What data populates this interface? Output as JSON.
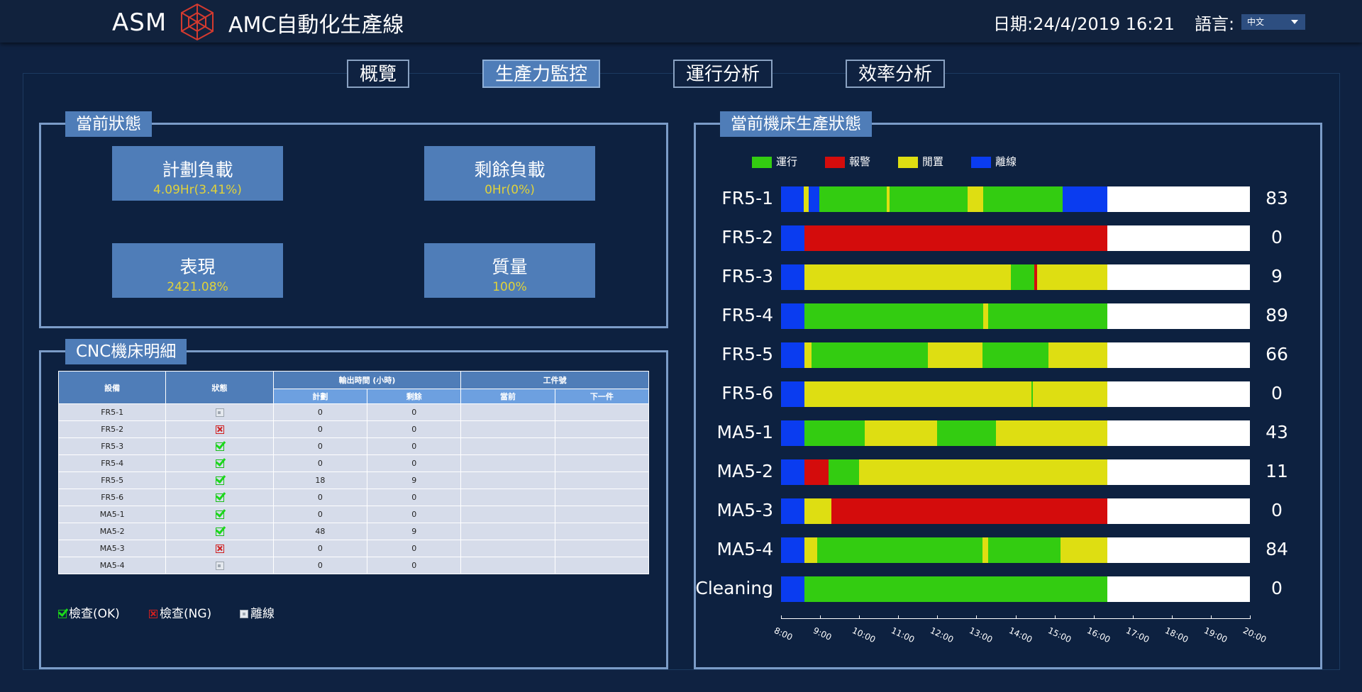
{
  "header": {
    "brand": "ASM",
    "title": "AMC自動化生產線",
    "date_label": "日期:24/4/2019 16:21",
    "language_label": "語言:",
    "language_value": "中文"
  },
  "nav": {
    "tabs": [
      {
        "label": "概覽",
        "active": false
      },
      {
        "label": "生產力監控",
        "active": true
      },
      {
        "label": "運行分析",
        "active": false
      },
      {
        "label": "效率分析",
        "active": false
      }
    ]
  },
  "status_panel": {
    "title": "當前狀態",
    "kpis": [
      {
        "label": "計劃負載",
        "value": "4.09Hr(3.41%)"
      },
      {
        "label": "剩餘負載",
        "value": "0Hr(0%)"
      },
      {
        "label": "表現",
        "value": "2421.08%"
      },
      {
        "label": "質量",
        "value": "100%"
      }
    ]
  },
  "cnc_panel": {
    "title": "CNC機床明細",
    "headers": {
      "equipment": "設備",
      "status": "狀態",
      "output_time": "輸出時間 (小時)",
      "plan": "計劃",
      "remain": "剩餘",
      "workpiece": "工件號",
      "current": "當前",
      "next": "下一件"
    },
    "rows": [
      {
        "equipment": "FR5-1",
        "status": "offline",
        "plan": "0",
        "remain": "0",
        "current": "",
        "next": ""
      },
      {
        "equipment": "FR5-2",
        "status": "ng",
        "plan": "0",
        "remain": "0",
        "current": "",
        "next": ""
      },
      {
        "equipment": "FR5-3",
        "status": "ok",
        "plan": "0",
        "remain": "0",
        "current": "",
        "next": ""
      },
      {
        "equipment": "FR5-4",
        "status": "ok",
        "plan": "0",
        "remain": "0",
        "current": "",
        "next": ""
      },
      {
        "equipment": "FR5-5",
        "status": "ok",
        "plan": "18",
        "remain": "9",
        "current": "",
        "next": ""
      },
      {
        "equipment": "FR5-6",
        "status": "ok",
        "plan": "0",
        "remain": "0",
        "current": "",
        "next": ""
      },
      {
        "equipment": "MA5-1",
        "status": "ok",
        "plan": "0",
        "remain": "0",
        "current": "",
        "next": ""
      },
      {
        "equipment": "MA5-2",
        "status": "ok",
        "plan": "48",
        "remain": "9",
        "current": "",
        "next": ""
      },
      {
        "equipment": "MA5-3",
        "status": "ng",
        "plan": "0",
        "remain": "0",
        "current": "",
        "next": ""
      },
      {
        "equipment": "MA5-4",
        "status": "offline",
        "plan": "0",
        "remain": "0",
        "current": "",
        "next": ""
      }
    ],
    "legend": {
      "ok": "檢查(OK)",
      "ng": "檢查(NG)",
      "offline": "離線"
    }
  },
  "machine_panel": {
    "title": "當前機床生產狀態",
    "legend": [
      {
        "key": "run",
        "label": "運行",
        "color": "#33cc11"
      },
      {
        "key": "alarm",
        "label": "報警",
        "color": "#d40c0c"
      },
      {
        "key": "idle",
        "label": "閒置",
        "color": "#dede12"
      },
      {
        "key": "offline",
        "label": "離線",
        "color": "#0a3cf0"
      }
    ]
  },
  "chart_data": {
    "type": "gantt",
    "x_ticks": [
      "8:00",
      "9:00",
      "10:00",
      "11:00",
      "12:00",
      "13:00",
      "14:00",
      "15:00",
      "16:00",
      "17:00",
      "18:00",
      "19:00",
      "20:00"
    ],
    "x_range_hours": [
      8,
      20
    ],
    "state_colors": {
      "run": "#33cc11",
      "alarm": "#d40c0c",
      "idle": "#dede12",
      "offline": "#0a3cf0"
    },
    "rows": [
      {
        "label": "FR5-1",
        "count": "83",
        "segments": [
          {
            "state": "offline",
            "start": 8.0,
            "end": 8.58
          },
          {
            "state": "idle",
            "start": 8.58,
            "end": 8.7
          },
          {
            "state": "offline",
            "start": 8.7,
            "end": 8.98
          },
          {
            "state": "run",
            "start": 8.98,
            "end": 10.7
          },
          {
            "state": "idle",
            "start": 10.7,
            "end": 10.78
          },
          {
            "state": "run",
            "start": 10.78,
            "end": 12.78
          },
          {
            "state": "idle",
            "start": 12.78,
            "end": 13.18
          },
          {
            "state": "run",
            "start": 13.18,
            "end": 15.2
          },
          {
            "state": "offline",
            "start": 15.2,
            "end": 16.35
          }
        ]
      },
      {
        "label": "FR5-2",
        "count": "0",
        "segments": [
          {
            "state": "offline",
            "start": 8.0,
            "end": 8.6
          },
          {
            "state": "alarm",
            "start": 8.6,
            "end": 16.35
          }
        ]
      },
      {
        "label": "FR5-3",
        "count": "9",
        "segments": [
          {
            "state": "offline",
            "start": 8.0,
            "end": 8.6
          },
          {
            "state": "idle",
            "start": 8.6,
            "end": 13.88
          },
          {
            "state": "run",
            "start": 13.88,
            "end": 14.48
          },
          {
            "state": "alarm",
            "start": 14.48,
            "end": 14.56
          },
          {
            "state": "idle",
            "start": 14.56,
            "end": 16.35
          }
        ]
      },
      {
        "label": "FR5-4",
        "count": "89",
        "segments": [
          {
            "state": "offline",
            "start": 8.0,
            "end": 8.6
          },
          {
            "state": "run",
            "start": 8.6,
            "end": 13.18
          },
          {
            "state": "idle",
            "start": 13.18,
            "end": 13.3
          },
          {
            "state": "run",
            "start": 13.3,
            "end": 16.35
          }
        ]
      },
      {
        "label": "FR5-5",
        "count": "66",
        "segments": [
          {
            "state": "offline",
            "start": 8.0,
            "end": 8.6
          },
          {
            "state": "idle",
            "start": 8.6,
            "end": 8.78
          },
          {
            "state": "run",
            "start": 8.78,
            "end": 11.75
          },
          {
            "state": "idle",
            "start": 11.75,
            "end": 13.15
          },
          {
            "state": "run",
            "start": 13.15,
            "end": 14.85
          },
          {
            "state": "idle",
            "start": 14.85,
            "end": 16.35
          }
        ]
      },
      {
        "label": "FR5-6",
        "count": "0",
        "segments": [
          {
            "state": "offline",
            "start": 8.0,
            "end": 8.6
          },
          {
            "state": "idle",
            "start": 8.6,
            "end": 14.4
          },
          {
            "state": "run",
            "start": 14.4,
            "end": 14.45
          },
          {
            "state": "idle",
            "start": 14.45,
            "end": 16.35
          }
        ]
      },
      {
        "label": "MA5-1",
        "count": "43",
        "segments": [
          {
            "state": "offline",
            "start": 8.0,
            "end": 8.6
          },
          {
            "state": "run",
            "start": 8.6,
            "end": 10.15
          },
          {
            "state": "idle",
            "start": 10.15,
            "end": 12.0
          },
          {
            "state": "run",
            "start": 12.0,
            "end": 13.5
          },
          {
            "state": "idle",
            "start": 13.5,
            "end": 16.35
          }
        ]
      },
      {
        "label": "MA5-2",
        "count": "11",
        "segments": [
          {
            "state": "offline",
            "start": 8.0,
            "end": 8.6
          },
          {
            "state": "alarm",
            "start": 8.6,
            "end": 9.22
          },
          {
            "state": "run",
            "start": 9.22,
            "end": 10.0
          },
          {
            "state": "idle",
            "start": 10.0,
            "end": 16.35
          }
        ]
      },
      {
        "label": "MA5-3",
        "count": "0",
        "segments": [
          {
            "state": "offline",
            "start": 8.0,
            "end": 8.6
          },
          {
            "state": "idle",
            "start": 8.6,
            "end": 9.28
          },
          {
            "state": "alarm",
            "start": 9.28,
            "end": 16.35
          }
        ]
      },
      {
        "label": "MA5-4",
        "count": "84",
        "segments": [
          {
            "state": "offline",
            "start": 8.0,
            "end": 8.6
          },
          {
            "state": "idle",
            "start": 8.6,
            "end": 8.92
          },
          {
            "state": "run",
            "start": 8.92,
            "end": 13.15
          },
          {
            "state": "idle",
            "start": 13.15,
            "end": 13.3
          },
          {
            "state": "run",
            "start": 13.3,
            "end": 15.15
          },
          {
            "state": "idle",
            "start": 15.15,
            "end": 16.35
          }
        ]
      },
      {
        "label": "Cleaning",
        "count": "0",
        "segments": [
          {
            "state": "offline",
            "start": 8.0,
            "end": 8.6
          },
          {
            "state": "run",
            "start": 8.6,
            "end": 16.35
          }
        ]
      }
    ]
  }
}
